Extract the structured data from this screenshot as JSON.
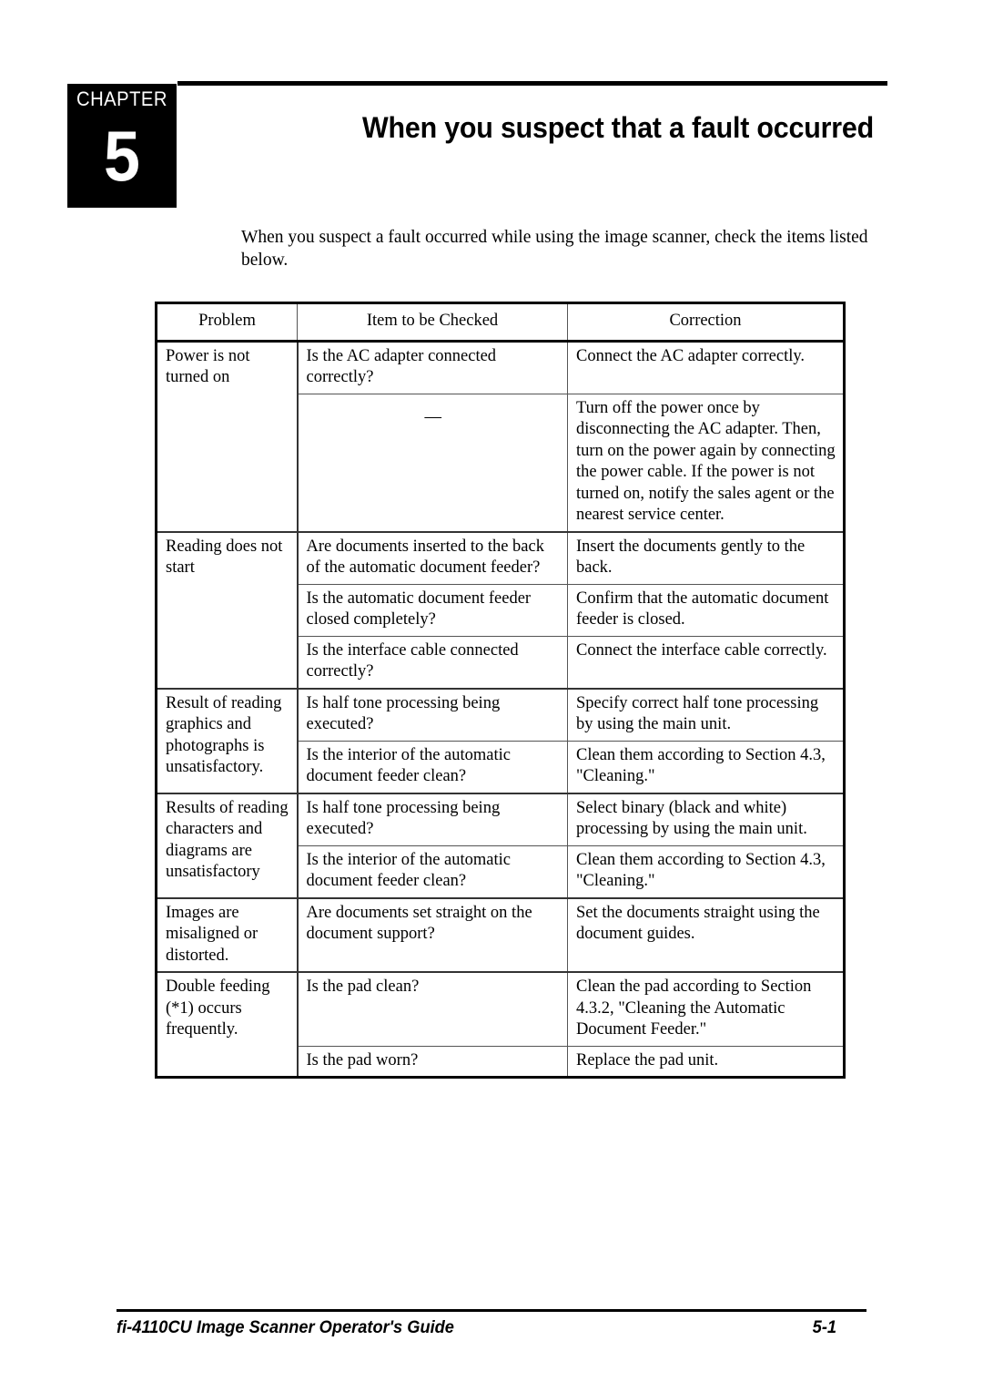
{
  "chapter": {
    "label": "CHAPTER",
    "number": "5",
    "title": "When you suspect that a fault occurred"
  },
  "intro": "When you suspect a fault occurred while using the image scanner, check the items listed below.",
  "table": {
    "headers": [
      "Problem",
      "Item to be Checked",
      "Correction"
    ],
    "groups": [
      {
        "problem": "Power is not turned on",
        "rows": [
          {
            "item": "Is the AC adapter connected correctly?",
            "correction": "Connect the AC adapter correctly."
          },
          {
            "item": "—",
            "correction": "Turn off the power once by disconnecting the AC adapter. Then, turn on the power again by connecting the power cable.  If the power is not turned on, notify the sales agent or the nearest service center."
          }
        ]
      },
      {
        "problem": "Reading does not start",
        "rows": [
          {
            "item": "Are documents inserted to the back of the automatic document feeder?",
            "correction": "Insert the documents gently to the back."
          },
          {
            "item": "Is the automatic document feeder closed completely?",
            "correction": "Confirm that the automatic document feeder is closed."
          },
          {
            "item": "Is the interface cable connected correctly?",
            "correction": "Connect the interface cable correctly."
          }
        ]
      },
      {
        "problem": "Result of reading graphics and photographs is unsatisfactory.",
        "rows": [
          {
            "item": "Is half tone processing being executed?",
            "correction": "Specify correct half tone processing by using the main unit."
          },
          {
            "item": "Is the interior of the automatic document feeder clean?",
            "correction": "Clean them according to Section 4.3, \"Cleaning.\""
          }
        ]
      },
      {
        "problem": "Results of reading characters and diagrams are unsatisfactory",
        "rows": [
          {
            "item": "Is half tone processing being executed?",
            "correction": "Select binary (black and white) processing by using the main unit."
          },
          {
            "item": "Is the interior of the automatic document feeder clean?",
            "correction": "Clean them according to Section 4.3, \"Cleaning.\""
          }
        ]
      },
      {
        "problem": "Images are misaligned or distorted.",
        "rows": [
          {
            "item": "Are documents set straight on the document support?",
            "correction": "Set the documents straight using the document guides."
          }
        ]
      },
      {
        "problem": "Double feeding (*1) occurs frequently.",
        "rows": [
          {
            "item": "Is the pad clean?",
            "correction": "Clean the pad according to Section 4.3.2, \"Cleaning the Automatic Document Feeder.\""
          },
          {
            "item": "Is the pad worn?",
            "correction": "Replace the pad unit."
          }
        ]
      }
    ]
  },
  "footer": {
    "document_title": "fi-4110CU Image Scanner Operator's Guide",
    "page_number": "5-1"
  }
}
